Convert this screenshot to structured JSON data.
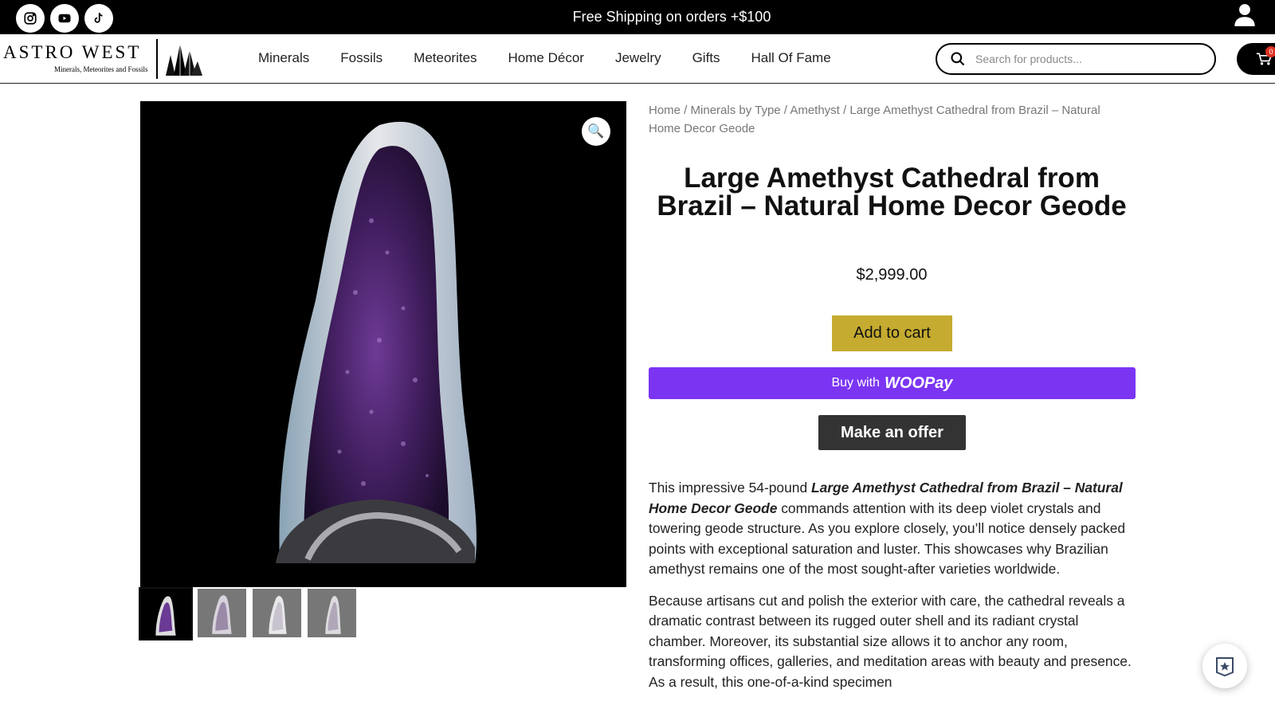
{
  "topbar": {
    "shipping_text": "Free Shipping on orders +$100",
    "social_icons": [
      "instagram-icon",
      "youtube-icon",
      "tiktok-icon"
    ],
    "account_icon": "user-icon"
  },
  "header": {
    "logo_text": "ASTRO WEST",
    "logo_tagline": "Minerals, Meteorites and Fossils",
    "nav": [
      "Minerals",
      "Fossils",
      "Meteorites",
      "Home Décor",
      "Jewelry",
      "Gifts",
      "Hall Of Fame"
    ],
    "search_placeholder": "Search for products...",
    "cart_count": "0"
  },
  "breadcrumb": {
    "items": [
      "Home",
      "Minerals by Type",
      "Amethyst"
    ],
    "current": "Large Amethyst Cathedral from Brazil – Natural Home Decor Geode"
  },
  "product": {
    "title": "Large Amethyst Cathedral from Brazil – Natural Home Decor Geode",
    "price": "$2,999.00",
    "add_to_cart_label": "Add to cart",
    "woopay_prefix": "Buy with",
    "woopay_brand": "WOOPay",
    "offer_label": "Make an offer",
    "zoom_icon": "🔍"
  },
  "description": {
    "p1_before": "This impressive 54-pound ",
    "p1_emphasis": "Large Amethyst Cathedral from Brazil – Natural Home Decor Geode",
    "p1_after": " commands attention with its deep violet crystals and towering geode structure. As you explore closely, you’ll notice densely packed points with exceptional saturation and luster. This showcases why Brazilian amethyst remains one of the most sought-after varieties worldwide.",
    "p2": "Because artisans cut and polish the exterior with care, the cathedral reveals a dramatic contrast between its rugged outer shell and its radiant crystal chamber. Moreover, its substantial size allows it to anchor any room, transforming offices, galleries, and meditation areas with beauty and presence. As a result, this one-of-a-kind specimen"
  },
  "colors": {
    "add_to_cart": "#c5ab2f",
    "woopay": "#7b35f2",
    "offer_button": "#333333",
    "amethyst": "#4a2468"
  }
}
